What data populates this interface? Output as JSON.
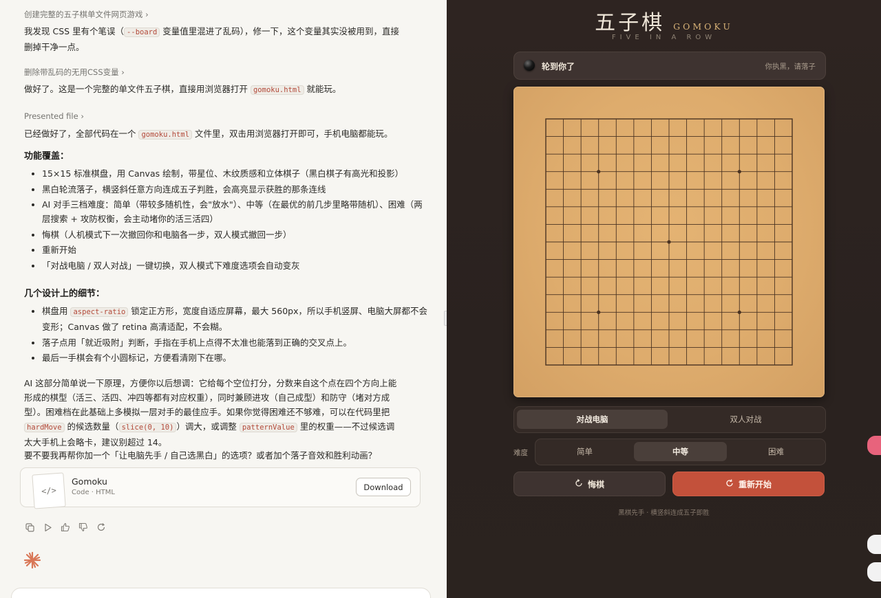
{
  "chat": {
    "step1": "创建完整的五子棋单文件网页游戏",
    "para1": {
      "a": "我发现 CSS 里有个笔误（",
      "code": "--board",
      "b": " 变量值里混进了乱码），修一下，这个变量其实没被用到，直接删掉干净一点。"
    },
    "step2": "删除带乱码的无用CSS变量",
    "para2": {
      "a": "做好了。这是一个完整的单文件五子棋，直接用浏览器打开 ",
      "code": "gomoku.html",
      "b": " 就能玩。"
    },
    "step3": "Presented file",
    "para3": {
      "a": "已经做好了，全部代码在一个 ",
      "code": "gomoku.html",
      "b": " 文件里，双击用浏览器打开即可，手机电脑都能玩。"
    },
    "features_heading": "功能覆盖：",
    "features": [
      "15×15 标准棋盘，用 Canvas 绘制，带星位、木纹质感和立体棋子（黑白棋子有高光和投影）",
      "黑白轮流落子，横竖斜任意方向连成五子判胜，会高亮显示获胜的那条连线",
      "AI 对手三档难度：简单（带较多随机性，会\"放水\"）、中等（在最优的前几步里略带随机）、困难（两层搜索 + 攻防权衡，会主动堵你的活三活四）",
      "悔棋（人机模式下一次撤回你和电脑各一步，双人模式撤回一步）",
      "重新开始",
      "「对战电脑 / 双人对战」一键切换，双人模式下难度选项会自动变灰"
    ],
    "details_heading": "几个设计上的细节：",
    "detail1": {
      "a": "棋盘用 ",
      "code": "aspect-ratio",
      "b": " 锁定正方形，宽度自适应屏幕，最大 560px，所以手机竖屏、电脑大屏都不会变形；Canvas 做了 retina 高清适配，不会糊。"
    },
    "detail2": "落子点用「就近吸附」判断，手指在手机上点得不太准也能落到正确的交叉点上。",
    "detail3": "最后一手棋会有个小圆标记，方便看清刚下在哪。",
    "para4": {
      "a": "AI 这部分简单说一下原理，方便你以后想调：它给每个空位打分，分数来自这个点在四个方向上能形成的棋型（活三、活四、冲四等都有对应权重），同时兼顾进攻（自己成型）和防守（堵对方成型）。困难档在此基础上多模拟一层对手的最佳应手。如果你觉得困难还不够难，可以在代码里把 ",
      "code1": "hardMove",
      "b": " 的候选数量（",
      "code2": "slice(0, 10)",
      "c": "）调大，或调整 ",
      "code3": "patternValue",
      "d": " 里的权重——不过候选调太大手机上会略卡，建议别超过 14。"
    },
    "para5": "要不要我再帮你加一个「让电脑先手 / 自己选黑白」的选项？或者加个落子音效和胜利动画？",
    "file": {
      "title": "Gomoku",
      "subtitle": "Code · HTML",
      "download": "Download",
      "thumb": "</>"
    }
  },
  "game": {
    "title_cn": "五子棋",
    "title_en": "GOMOKU",
    "subtitle": "FIVE IN A ROW",
    "status": {
      "main": "轮到你了",
      "hint": "你执黑，请落子"
    },
    "board": {
      "size": 15,
      "star_points": [
        [
          3,
          3
        ],
        [
          11,
          3
        ],
        [
          7,
          7
        ],
        [
          3,
          11
        ],
        [
          11,
          11
        ]
      ],
      "line_color": "#4a3322"
    },
    "modes": [
      {
        "label": "对战电脑",
        "active": true
      },
      {
        "label": "双人对战",
        "active": false
      }
    ],
    "difficulty_label": "难度",
    "difficulties": [
      {
        "label": "简单",
        "active": false
      },
      {
        "label": "中等",
        "active": true
      },
      {
        "label": "困难",
        "active": false
      }
    ],
    "undo_label": "悔棋",
    "restart_label": "重新开始",
    "footer": "黑棋先手 · 横竖斜连成五子即胜"
  },
  "colors": {
    "accent_red": "#c3513b",
    "board_wood": "#deac6d",
    "panel_dark": "#2b231f",
    "brand_gold": "#d8b277"
  }
}
